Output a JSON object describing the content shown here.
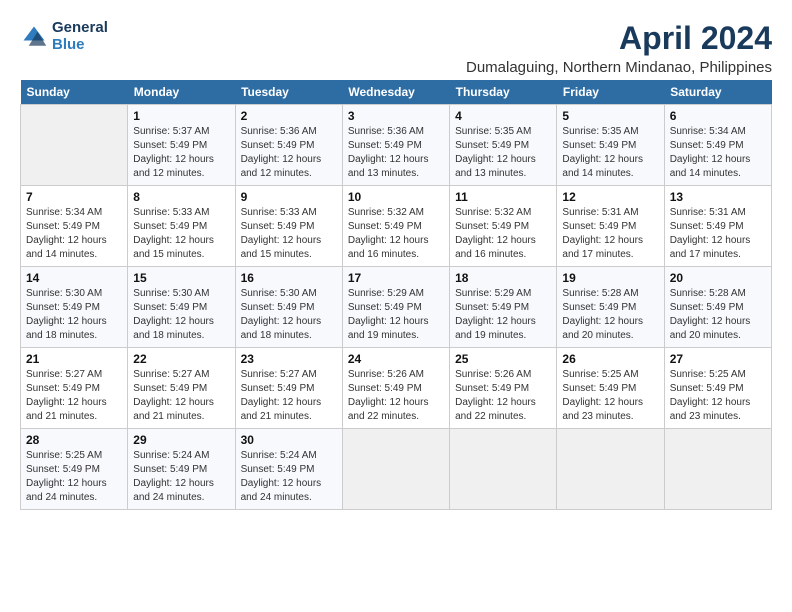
{
  "header": {
    "logo_line1": "General",
    "logo_line2": "Blue",
    "month_title": "April 2024",
    "location": "Dumalaguing, Northern Mindanao, Philippines"
  },
  "days_of_week": [
    "Sunday",
    "Monday",
    "Tuesday",
    "Wednesday",
    "Thursday",
    "Friday",
    "Saturday"
  ],
  "weeks": [
    [
      {
        "day": "",
        "empty": true
      },
      {
        "day": "1",
        "sunrise": "5:37 AM",
        "sunset": "5:49 PM",
        "daylight": "12 hours and 12 minutes."
      },
      {
        "day": "2",
        "sunrise": "5:36 AM",
        "sunset": "5:49 PM",
        "daylight": "12 hours and 12 minutes."
      },
      {
        "day": "3",
        "sunrise": "5:36 AM",
        "sunset": "5:49 PM",
        "daylight": "12 hours and 13 minutes."
      },
      {
        "day": "4",
        "sunrise": "5:35 AM",
        "sunset": "5:49 PM",
        "daylight": "12 hours and 13 minutes."
      },
      {
        "day": "5",
        "sunrise": "5:35 AM",
        "sunset": "5:49 PM",
        "daylight": "12 hours and 14 minutes."
      },
      {
        "day": "6",
        "sunrise": "5:34 AM",
        "sunset": "5:49 PM",
        "daylight": "12 hours and 14 minutes."
      }
    ],
    [
      {
        "day": "7",
        "sunrise": "5:34 AM",
        "sunset": "5:49 PM",
        "daylight": "12 hours and 14 minutes."
      },
      {
        "day": "8",
        "sunrise": "5:33 AM",
        "sunset": "5:49 PM",
        "daylight": "12 hours and 15 minutes."
      },
      {
        "day": "9",
        "sunrise": "5:33 AM",
        "sunset": "5:49 PM",
        "daylight": "12 hours and 15 minutes."
      },
      {
        "day": "10",
        "sunrise": "5:32 AM",
        "sunset": "5:49 PM",
        "daylight": "12 hours and 16 minutes."
      },
      {
        "day": "11",
        "sunrise": "5:32 AM",
        "sunset": "5:49 PM",
        "daylight": "12 hours and 16 minutes."
      },
      {
        "day": "12",
        "sunrise": "5:31 AM",
        "sunset": "5:49 PM",
        "daylight": "12 hours and 17 minutes."
      },
      {
        "day": "13",
        "sunrise": "5:31 AM",
        "sunset": "5:49 PM",
        "daylight": "12 hours and 17 minutes."
      }
    ],
    [
      {
        "day": "14",
        "sunrise": "5:30 AM",
        "sunset": "5:49 PM",
        "daylight": "12 hours and 18 minutes."
      },
      {
        "day": "15",
        "sunrise": "5:30 AM",
        "sunset": "5:49 PM",
        "daylight": "12 hours and 18 minutes."
      },
      {
        "day": "16",
        "sunrise": "5:30 AM",
        "sunset": "5:49 PM",
        "daylight": "12 hours and 18 minutes."
      },
      {
        "day": "17",
        "sunrise": "5:29 AM",
        "sunset": "5:49 PM",
        "daylight": "12 hours and 19 minutes."
      },
      {
        "day": "18",
        "sunrise": "5:29 AM",
        "sunset": "5:49 PM",
        "daylight": "12 hours and 19 minutes."
      },
      {
        "day": "19",
        "sunrise": "5:28 AM",
        "sunset": "5:49 PM",
        "daylight": "12 hours and 20 minutes."
      },
      {
        "day": "20",
        "sunrise": "5:28 AM",
        "sunset": "5:49 PM",
        "daylight": "12 hours and 20 minutes."
      }
    ],
    [
      {
        "day": "21",
        "sunrise": "5:27 AM",
        "sunset": "5:49 PM",
        "daylight": "12 hours and 21 minutes."
      },
      {
        "day": "22",
        "sunrise": "5:27 AM",
        "sunset": "5:49 PM",
        "daylight": "12 hours and 21 minutes."
      },
      {
        "day": "23",
        "sunrise": "5:27 AM",
        "sunset": "5:49 PM",
        "daylight": "12 hours and 21 minutes."
      },
      {
        "day": "24",
        "sunrise": "5:26 AM",
        "sunset": "5:49 PM",
        "daylight": "12 hours and 22 minutes."
      },
      {
        "day": "25",
        "sunrise": "5:26 AM",
        "sunset": "5:49 PM",
        "daylight": "12 hours and 22 minutes."
      },
      {
        "day": "26",
        "sunrise": "5:25 AM",
        "sunset": "5:49 PM",
        "daylight": "12 hours and 23 minutes."
      },
      {
        "day": "27",
        "sunrise": "5:25 AM",
        "sunset": "5:49 PM",
        "daylight": "12 hours and 23 minutes."
      }
    ],
    [
      {
        "day": "28",
        "sunrise": "5:25 AM",
        "sunset": "5:49 PM",
        "daylight": "12 hours and 24 minutes."
      },
      {
        "day": "29",
        "sunrise": "5:24 AM",
        "sunset": "5:49 PM",
        "daylight": "12 hours and 24 minutes."
      },
      {
        "day": "30",
        "sunrise": "5:24 AM",
        "sunset": "5:49 PM",
        "daylight": "12 hours and 24 minutes."
      },
      {
        "day": "",
        "empty": true
      },
      {
        "day": "",
        "empty": true
      },
      {
        "day": "",
        "empty": true
      },
      {
        "day": "",
        "empty": true
      }
    ]
  ],
  "labels": {
    "sunrise_label": "Sunrise:",
    "sunset_label": "Sunset:",
    "daylight_label": "Daylight:"
  }
}
